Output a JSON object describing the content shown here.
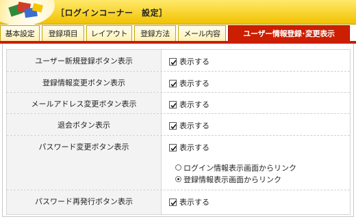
{
  "header": {
    "title": "［ログインコーナー　設定］"
  },
  "tabs": [
    {
      "label": "基本設定",
      "active": false
    },
    {
      "label": "登録項目",
      "active": false
    },
    {
      "label": "レイアウト",
      "active": false
    },
    {
      "label": "登録方法",
      "active": false
    },
    {
      "label": "メール内容",
      "active": false
    },
    {
      "label": "ユーザー情報登録･変更表示",
      "active": true
    }
  ],
  "colors": {
    "accent": "#cc1e00",
    "header_gradient_top": "#ffe96a",
    "header_gradient_bottom": "#f2c200"
  },
  "settings": {
    "rows": [
      {
        "label": "ユーザー新規登録ボタン表示",
        "checkbox_label": "表示する",
        "checked": true
      },
      {
        "label": "登録情報変更ボタン表示",
        "checkbox_label": "表示する",
        "checked": true
      },
      {
        "label": "メールアドレス変更ボタン表示",
        "checkbox_label": "表示する",
        "checked": true
      },
      {
        "label": "退会ボタン表示",
        "checkbox_label": "表示する",
        "checked": true
      },
      {
        "label": "パスワード変更ボタン表示",
        "checkbox_label": "表示する",
        "checked": true,
        "radios": [
          {
            "label": "ログイン情報表示画面からリンク",
            "selected": false
          },
          {
            "label": "登録情報表示画面からリンク",
            "selected": true
          }
        ]
      },
      {
        "label": "パスワード再発行ボタン表示",
        "checkbox_label": "表示する",
        "checked": true
      }
    ]
  }
}
